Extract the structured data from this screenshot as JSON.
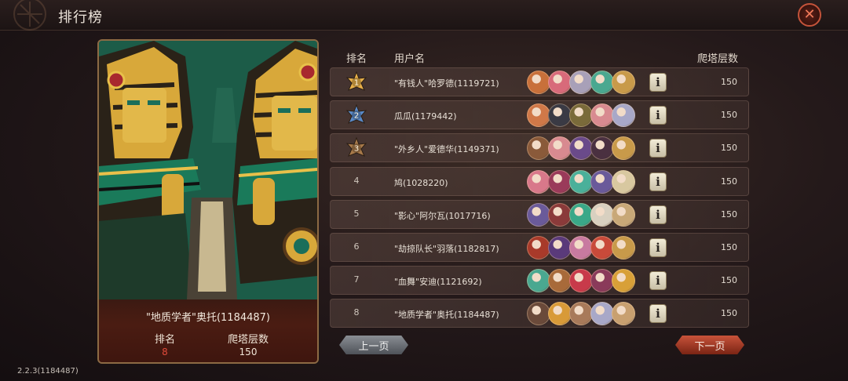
{
  "header": {
    "title": "排行榜"
  },
  "columns": {
    "rank": "排名",
    "username": "用户名",
    "floors": "爬塔层数"
  },
  "hero": {
    "name": "\"地质学者\"奥托(1184487)",
    "rank_label": "排名",
    "rank_value": "8",
    "floors_label": "爬塔层数",
    "floors_value": "150"
  },
  "rows": [
    {
      "rank": "1",
      "name": "\"有钱人\"哈罗德(1119721)",
      "floors": "150",
      "badge": "gold",
      "avatars": [
        "#c8703a",
        "#d86a7a",
        "#a8a0b8",
        "#4aa890",
        "#c89a4a"
      ]
    },
    {
      "rank": "2",
      "name": "瓜瓜(1179442)",
      "floors": "150",
      "badge": "blue",
      "avatars": [
        "#d07848",
        "#3a3a44",
        "#7a6a3a",
        "#d88a90",
        "#a8a8c8"
      ]
    },
    {
      "rank": "3",
      "name": "\"外乡人\"爱德华(1149371)",
      "floors": "150",
      "badge": "bronze",
      "avatars": [
        "#8a5a3a",
        "#d88a90",
        "#6a4a8a",
        "#4a3040",
        "#c89a4a"
      ]
    },
    {
      "rank": "4",
      "name": "鸠(1028220)",
      "floors": "150",
      "badge": "",
      "avatars": [
        "#d8788a",
        "#9a3a5a",
        "#4ab09a",
        "#6a5a9a",
        "#d8c8a0"
      ]
    },
    {
      "rank": "5",
      "name": "\"影心\"阿尔瓦(1017716)",
      "floors": "150",
      "badge": "",
      "avatars": [
        "#6a5a9a",
        "#8a3a3a",
        "#3aa888",
        "#d8d0c0",
        "#c8a878"
      ]
    },
    {
      "rank": "6",
      "name": "\"劫掠队长\"羽落(1182817)",
      "floors": "150",
      "badge": "",
      "avatars": [
        "#a83a2a",
        "#5a3a7a",
        "#c87aa0",
        "#c84a3a",
        "#c89a4a"
      ]
    },
    {
      "rank": "7",
      "name": "\"血舞\"安迪(1121692)",
      "floors": "150",
      "badge": "",
      "avatars": [
        "#4aa890",
        "#a86a3a",
        "#c83a4a",
        "#8a3a5a",
        "#d8a038"
      ]
    },
    {
      "rank": "8",
      "name": "\"地质学者\"奥托(1184487)",
      "floors": "150",
      "badge": "",
      "avatars": [
        "#6a4a3a",
        "#d89a38",
        "#a87a5a",
        "#a8a8c8",
        "#c8a070"
      ]
    }
  ],
  "pagination": {
    "prev": "上一页",
    "next": "下一页"
  },
  "footer": {
    "version": "2.2.3(1184487)"
  },
  "colors": {
    "accent_red": "#c8533a",
    "gold": "#e8b04a",
    "blue": "#5a8ac8",
    "bronze": "#a87a4a",
    "rank8": "#e04a3a"
  }
}
